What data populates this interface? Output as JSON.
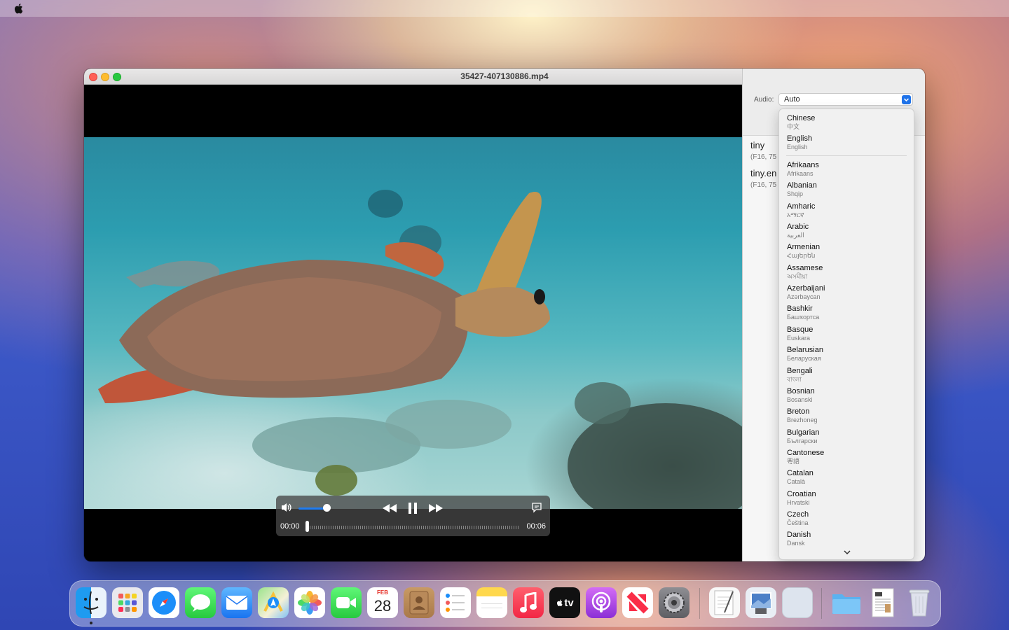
{
  "window": {
    "title": "35427-407130886.mp4"
  },
  "player": {
    "current_time": "00:00",
    "duration": "00:06",
    "volume_fraction": 0.85,
    "progress_fraction": 0.0
  },
  "panel": {
    "audio_label": "Audio:",
    "audio_value": "Auto",
    "models": [
      {
        "name": "tiny",
        "detail": "(F16, 75"
      },
      {
        "name": "tiny.en",
        "detail": "(F16, 75"
      }
    ]
  },
  "dropdown": {
    "pinned": [
      {
        "name": "Chinese",
        "native": "中文"
      },
      {
        "name": "English",
        "native": "English"
      }
    ],
    "languages": [
      {
        "name": "Afrikaans",
        "native": "Afrikaans"
      },
      {
        "name": "Albanian",
        "native": "Shqip"
      },
      {
        "name": "Amharic",
        "native": "አማርኛ"
      },
      {
        "name": "Arabic",
        "native": "العربية"
      },
      {
        "name": "Armenian",
        "native": "Հայերեն"
      },
      {
        "name": "Assamese",
        "native": "অসমীয়া"
      },
      {
        "name": "Azerbaijani",
        "native": "Azərbaycan"
      },
      {
        "name": "Bashkir",
        "native": "Башҡортса"
      },
      {
        "name": "Basque",
        "native": "Euskara"
      },
      {
        "name": "Belarusian",
        "native": "Беларуская"
      },
      {
        "name": "Bengali",
        "native": "বাংলা"
      },
      {
        "name": "Bosnian",
        "native": "Bosanski"
      },
      {
        "name": "Breton",
        "native": "Brezhoneg"
      },
      {
        "name": "Bulgarian",
        "native": "Български"
      },
      {
        "name": "Cantonese",
        "native": "粵語"
      },
      {
        "name": "Catalan",
        "native": "Català"
      },
      {
        "name": "Croatian",
        "native": "Hrvatski"
      },
      {
        "name": "Czech",
        "native": "Čeština"
      },
      {
        "name": "Danish",
        "native": "Dansk"
      }
    ]
  },
  "dock": {
    "calendar_month": "FEB",
    "calendar_day": "28",
    "tv_label": "tv"
  }
}
